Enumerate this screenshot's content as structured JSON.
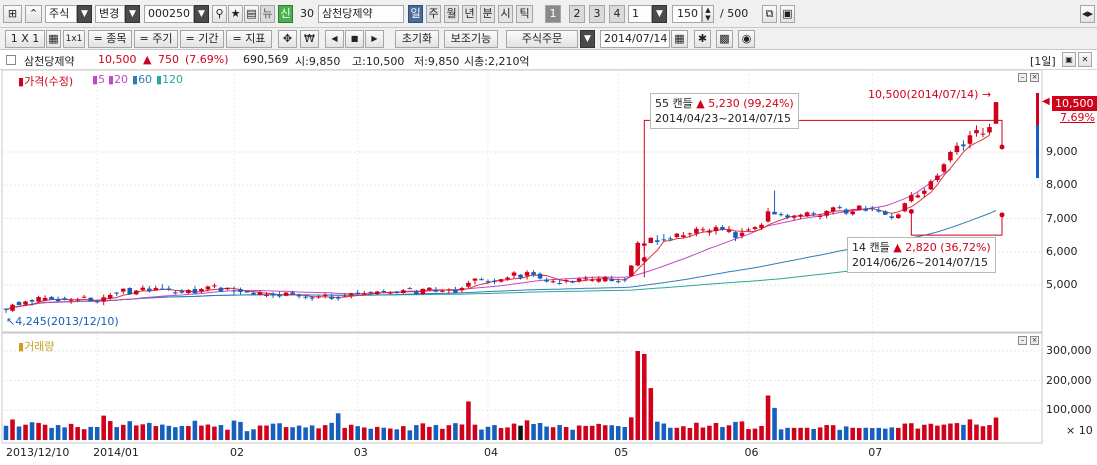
{
  "toolbar1": {
    "market": "주식",
    "change": "변경",
    "code": "000250",
    "new_label": "뉴",
    "credit_label": "신",
    "count": "30",
    "stock_name": "삼천당제약",
    "periods": [
      "일",
      "주",
      "월",
      "년",
      "분",
      "시",
      "틱"
    ],
    "active_period": "일",
    "nums": [
      "1",
      "2",
      "3",
      "4"
    ],
    "num_select": "1",
    "range_value": "150",
    "range_max": "/ 500"
  },
  "toolbar2": {
    "layout_label": "1 X 1",
    "layout_b": "1x1",
    "item_btn": "= 종목",
    "cycle_btn": "= 주기",
    "period_btn": "= 기간",
    "indicator_btn": "= 지표",
    "won_label": "₩",
    "reset_btn": "초기화",
    "aux_btn": "보조기능",
    "order_btn": "주식주문",
    "date_value": "2014/07/14"
  },
  "info": {
    "name": "삼천당제약",
    "price": "10,500",
    "change_arrow": "▲",
    "change": "750",
    "change_pct": "(7.69%)",
    "volume": "690,569",
    "open": "시:9,850",
    "high": "고:10,500",
    "low": "저:9,850",
    "market_cap": "시총:2,210억",
    "period_tag": "[1일]"
  },
  "legend": {
    "price_label": "가격(수정)",
    "ma": [
      "5",
      "20",
      "60",
      "120"
    ],
    "volume_label": "거래량"
  },
  "colors": {
    "up": "#d0021b",
    "down": "#1560bd",
    "ma5": "#e0303a",
    "ma20": "#c04ac8",
    "ma60": "#2f7fb5",
    "ma120": "#2aa89a"
  },
  "annotations": {
    "high_label": "10,500(2014/07/14)",
    "low_label": "4,245(2013/12/10)",
    "callout1_line1": "55 캔들",
    "callout1_arrow": "▲",
    "callout1_val": "5,230 (99,24%)",
    "callout1_line2": "2014/04/23~2014/07/15",
    "callout2_line1": "14 캔들",
    "callout2_arrow": "▲",
    "callout2_val": "2,820 (36,72%)",
    "callout2_line2": "2014/06/26~2014/07/15",
    "price_tag": "10,500",
    "pct_tag": "7.69%"
  },
  "chart_data": {
    "type": "candlestick",
    "price_axis": [
      "9,000",
      "8,000",
      "7,000",
      "6,000",
      "5,000"
    ],
    "price_ticks": [
      9000,
      8000,
      7000,
      6000,
      5000
    ],
    "volume_axis": [
      "300,000",
      "200,000",
      "100,000"
    ],
    "volume_ticks": [
      300000,
      200000,
      100000
    ],
    "volume_unit": "× 10",
    "x_labels": [
      "2013/12/10",
      "2014/01",
      "02",
      "03",
      "04",
      "05",
      "06",
      "07"
    ],
    "x_label_index": [
      0,
      14,
      35,
      54,
      74,
      94,
      114,
      133
    ],
    "ohlc": [
      [
        4290,
        4293,
        4161,
        4255
      ],
      [
        4224,
        4436,
        4195,
        4406
      ],
      [
        4487,
        4520,
        4395,
        4395
      ],
      [
        4413,
        4523,
        4365,
        4505
      ],
      [
        4549,
        4577,
        4377,
        4502
      ],
      [
        4504,
        4675,
        4482,
        4636
      ],
      [
        4530,
        4691,
        4530,
        4612
      ],
      [
        4642,
        4662,
        4557,
        4562
      ],
      [
        4580,
        4653,
        4501,
        4512
      ],
      [
        4603,
        4651,
        4536,
        4557
      ],
      [
        4526,
        4608,
        4434,
        4556
      ],
      [
        4565,
        4618,
        4498,
        4567
      ],
      [
        4618,
        4702,
        4617,
        4646
      ],
      [
        4618,
        4626,
        4505,
        4513
      ],
      [
        4507,
        4561,
        4442,
        4501
      ],
      [
        4499,
        4713,
        4393,
        4630
      ],
      [
        4595,
        4764,
        4535,
        4702
      ],
      [
        4771,
        4792,
        4667,
        4762
      ],
      [
        4803,
        4900,
        4730,
        4888
      ],
      [
        4909,
        4934,
        4706,
        4723
      ],
      [
        4718,
        4851,
        4695,
        4833
      ],
      [
        4852,
        4984,
        4805,
        4918
      ],
      [
        4893,
        4972,
        4770,
        4824
      ],
      [
        4847,
        4978,
        4831,
        4908
      ],
      [
        4890,
        5026,
        4853,
        4867
      ],
      [
        4893,
        4977,
        4827,
        4849
      ],
      [
        4777,
        4832,
        4710,
        4744
      ],
      [
        4818,
        4881,
        4737,
        4770
      ],
      [
        4760,
        4874,
        4729,
        4851
      ],
      [
        4879,
        4964,
        4727,
        4752
      ],
      [
        4810,
        4910,
        4755,
        4879
      ],
      [
        4870,
        4979,
        4802,
        4957
      ],
      [
        4977,
        5046,
        4906,
        4989
      ],
      [
        4917,
        4949,
        4787,
        4802
      ],
      [
        4873,
        4921,
        4841,
        4913
      ],
      [
        4836,
        4953,
        4710,
        4810
      ],
      [
        4871,
        4924,
        4706,
        4791
      ],
      [
        4818,
        4822,
        4770,
        4773
      ],
      [
        4765,
        4792,
        4708,
        4717
      ],
      [
        4702,
        4840,
        4687,
        4779
      ],
      [
        4687,
        4784,
        4634,
        4700
      ],
      [
        4741,
        4793,
        4610,
        4687
      ],
      [
        4711,
        4802,
        4614,
        4657
      ],
      [
        4674,
        4790,
        4665,
        4771
      ],
      [
        4775,
        4822,
        4701,
        4715
      ],
      [
        4715,
        4741,
        4593,
        4658
      ],
      [
        4647,
        4684,
        4569,
        4617
      ],
      [
        4628,
        4669,
        4520,
        4592
      ],
      [
        4626,
        4689,
        4589,
        4651
      ],
      [
        4670,
        4758,
        4601,
        4706
      ],
      [
        4653,
        4736,
        4543,
        4587
      ],
      [
        4638,
        4674,
        4525,
        4593
      ],
      [
        4646,
        4743,
        4635,
        4659
      ],
      [
        4686,
        4759,
        4593,
        4751
      ],
      [
        4768,
        4855,
        4715,
        4730
      ],
      [
        4733,
        4822,
        4705,
        4746
      ],
      [
        4791,
        4815,
        4720,
        4766
      ],
      [
        4724,
        4823,
        4694,
        4804
      ],
      [
        4820,
        4874,
        4759,
        4814
      ],
      [
        4743,
        4812,
        4713,
        4771
      ],
      [
        4804,
        4820,
        4735,
        4757
      ],
      [
        4759,
        4877,
        4733,
        4845
      ],
      [
        4906,
        4941,
        4873,
        4903
      ],
      [
        4808,
        4858,
        4699,
        4742
      ],
      [
        4728,
        4897,
        4701,
        4882
      ],
      [
        4860,
        4938,
        4806,
        4917
      ],
      [
        4857,
        4938,
        4776,
        4800
      ],
      [
        4823,
        4874,
        4779,
        4826
      ],
      [
        4859,
        4900,
        4738,
        4869
      ],
      [
        4857,
        4946,
        4751,
        4774
      ],
      [
        4843,
        4951,
        4774,
        4911
      ],
      [
        4950,
        5125,
        4908,
        5066
      ],
      [
        5130,
        5202,
        5019,
        5195
      ],
      [
        5175,
        5224,
        5137,
        5160
      ],
      [
        5113,
        5165,
        5026,
        5084
      ],
      [
        5128,
        5194,
        5023,
        5090
      ],
      [
        5101,
        5185,
        5068,
        5176
      ],
      [
        5169,
        5257,
        5127,
        5223
      ],
      [
        5280,
        5416,
        5205,
        5376
      ],
      [
        5310,
        5327,
        5163,
        5220
      ],
      [
        5279,
        5443,
        5166,
        5387
      ],
      [
        5388,
        5444,
        5244,
        5306
      ],
      [
        5339,
        5378,
        5163,
        5196
      ],
      [
        5160,
        5218,
        5074,
        5105
      ],
      [
        5106,
        5183,
        5052,
        5112
      ],
      [
        5059,
        5182,
        5012,
        5046
      ],
      [
        5117,
        5184,
        5048,
        5150
      ],
      [
        5116,
        5138,
        5057,
        5073
      ],
      [
        5113,
        5233,
        5066,
        5189
      ],
      [
        5181,
        5272,
        5113,
        5201
      ],
      [
        5137,
        5251,
        5091,
        5156
      ],
      [
        5101,
        5265,
        5067,
        5182
      ],
      [
        5111,
        5264,
        5091,
        5239
      ],
      [
        5181,
        5278,
        5109,
        5115
      ],
      [
        5116,
        5204,
        5051,
        5112
      ],
      [
        5167,
        5223,
        5087,
        5146
      ],
      [
        5270,
        5600,
        5250,
        5585
      ],
      [
        5585,
        6320,
        5560,
        6269
      ],
      [
        6182,
        6325,
        6030,
        6249
      ],
      [
        6264,
        6438,
        6254,
        6417
      ],
      [
        6345,
        6499,
        6206,
        6294
      ],
      [
        6373,
        6536,
        6285,
        6346
      ],
      [
        6402,
        6461,
        6311,
        6380
      ],
      [
        6441,
        6566,
        6412,
        6544
      ],
      [
        6441,
        6593,
        6402,
        6495
      ],
      [
        6526,
        6576,
        6427,
        6554
      ],
      [
        6546,
        6750,
        6466,
        6691
      ],
      [
        6645,
        6748,
        6584,
        6676
      ],
      [
        6576,
        6690,
        6483,
        6639
      ],
      [
        6622,
        6799,
        6520,
        6740
      ],
      [
        6744,
        6805,
        6629,
        6665
      ],
      [
        6598,
        6776,
        6557,
        6653
      ],
      [
        6592,
        6609,
        6316,
        6421
      ],
      [
        6479,
        6707,
        6395,
        6573
      ],
      [
        6656,
        6722,
        6596,
        6669
      ],
      [
        6685,
        6767,
        6629,
        6739
      ],
      [
        6716,
        6860,
        6654,
        6810
      ],
      [
        6909,
        7320,
        6877,
        7215
      ],
      [
        7201,
        7840,
        7141,
        7122
      ],
      [
        7130,
        7187,
        7062,
        7121
      ],
      [
        7096,
        7146,
        6982,
        7029
      ],
      [
        7021,
        7107,
        6943,
        7067
      ],
      [
        7069,
        7144,
        6977,
        7110
      ],
      [
        7068,
        7212,
        7044,
        7185
      ],
      [
        7156,
        7209,
        7072,
        7124
      ],
      [
        7072,
        7144,
        6968,
        7076
      ],
      [
        7083,
        7250,
        7005,
        7227
      ],
      [
        7210,
        7359,
        7115,
        7335
      ],
      [
        7341,
        7400,
        7285,
        7312
      ],
      [
        7272,
        7308,
        7103,
        7149
      ],
      [
        7128,
        7260,
        7090,
        7207
      ],
      [
        7262,
        7405,
        7238,
        7387
      ],
      [
        7291,
        7379,
        7208,
        7233
      ],
      [
        7308,
        7382,
        7218,
        7301
      ],
      [
        7257,
        7342,
        7176,
        7210
      ],
      [
        7218,
        7248,
        7104,
        7112
      ],
      [
        7064,
        7143,
        6967,
        7017
      ],
      [
        7014,
        7152,
        6987,
        7121
      ],
      [
        7219,
        7481,
        7188,
        7459
      ],
      [
        7522,
        7792,
        7479,
        7702
      ],
      [
        7634,
        7777,
        7619,
        7696
      ],
      [
        7742,
        7912,
        7638,
        7836
      ],
      [
        7875,
        8173,
        7859,
        8121
      ],
      [
        8158,
        8359,
        8096,
        8291
      ],
      [
        8407,
        8670,
        8364,
        8629
      ],
      [
        8748,
        9036,
        8681,
        8999
      ],
      [
        8998,
        9290,
        8912,
        9188
      ],
      [
        9228,
        9353,
        9036,
        9172
      ],
      [
        9246,
        9633,
        9111,
        9503
      ],
      [
        9563,
        9803,
        9460,
        9660
      ],
      [
        9547,
        9726,
        9444,
        9552
      ],
      [
        9588,
        9848,
        9520,
        9750
      ],
      [
        9850,
        10500,
        9850,
        10500
      ]
    ],
    "ma5": [
      4255,
      4330,
      4352,
      4390,
      4413,
      4487,
      4530,
      4563,
      4566,
      4567,
      4560,
      4553,
      4568,
      4552,
      4537,
      4571,
      4598,
      4622,
      4697,
      4723,
      4782,
      4825,
      4817,
      4841,
      4868,
      4873,
      4838,
      4828,
      4816,
      4793,
      4799,
      4842,
      4866,
      4876,
      4908,
      4894,
      4861,
      4818,
      4801,
      4774,
      4752,
      4731,
      4704,
      4703,
      4706,
      4698,
      4684,
      4651,
      4647,
      4645,
      4631,
      4626,
      4639,
      4659,
      4684,
      4692,
      4730,
      4759,
      4772,
      4780,
      4782,
      4798,
      4818,
      4810,
      4826,
      4858,
      4849,
      4853,
      4843,
      4837,
      4860,
      4889,
      4965,
      5023,
      5063,
      5119,
      5141,
      5155,
      5190,
      5197,
      5257,
      5302,
      5297,
      5283,
      5221,
      5153,
      5121,
      5097,
      5114,
      5142,
      5164,
      5186,
      5193,
      5179,
      5161,
      5157,
      5256,
      5475,
      5662,
      5859,
      6045,
      6315,
      6337,
      6396,
      6412,
      6464,
      6533,
      6592,
      6611,
      6640,
      6673,
      6675,
      6624,
      6618,
      6600,
      6611,
      6683,
      6801,
      6886,
      6955,
      7023,
      7083,
      7061,
      7082,
      7101,
      7119,
      7161,
      7215,
      7234,
      7224,
      7275,
      7272,
      7288,
      7298,
      7253,
      7200,
      7152,
      7203,
      7282,
      7351,
      7485,
      7643,
      7784,
      8019,
      8291,
      8507,
      8753,
      8995,
      9183,
      9283,
      9383,
      9505
    ],
    "ma20": [
      4255,
      4330,
      4352,
      4390,
      4413,
      4447,
      4464,
      4476,
      4480,
      4488,
      4494,
      4500,
      4511,
      4511,
      4510,
      4518,
      4530,
      4543,
      4561,
      4569,
      4592,
      4617,
      4630,
      4649,
      4667,
      4678,
      4687,
      4700,
      4717,
      4729,
      4745,
      4767,
      4788,
      4806,
      4821,
      4830,
      4834,
      4835,
      4833,
      4834,
      4827,
      4822,
      4814,
      4811,
      4800,
      4790,
      4784,
      4776,
      4770,
      4770,
      4761,
      4747,
      4740,
      4737,
      4736,
      4743,
      4749,
      4759,
      4765,
      4768,
      4777,
      4786,
      4798,
      4802,
      4811,
      4824,
      4831,
      4842,
      4852,
      4861,
      4870,
      4886,
      4906,
      4926,
      4940,
      4958,
      4979,
      5004,
      5032,
      5058,
      5083,
      5112,
      5134,
      5150,
      5162,
      5174,
      5185,
      5194,
      5209,
      5224,
      5231,
      5239,
      5241,
      5233,
      5234,
      5236,
      5258,
      5314,
      5376,
      5437,
      5502,
      5571,
      5643,
      5719,
      5783,
      5861,
      5939,
      6018,
      6100,
      6164,
      6238,
      6315,
      6386,
      6455,
      6526,
      6609,
      6697,
      6777,
      6820,
      6861,
      6901,
      6942,
      6987,
      7018,
      7049,
      7078,
      7113,
      7148,
      7178,
      7214,
      7229,
      7253,
      7288,
      7318,
      7346,
      7380,
      7446,
      7520,
      7599,
      7687,
      7807,
      7941,
      8079,
      8217,
      8350,
      8473
    ]
  }
}
